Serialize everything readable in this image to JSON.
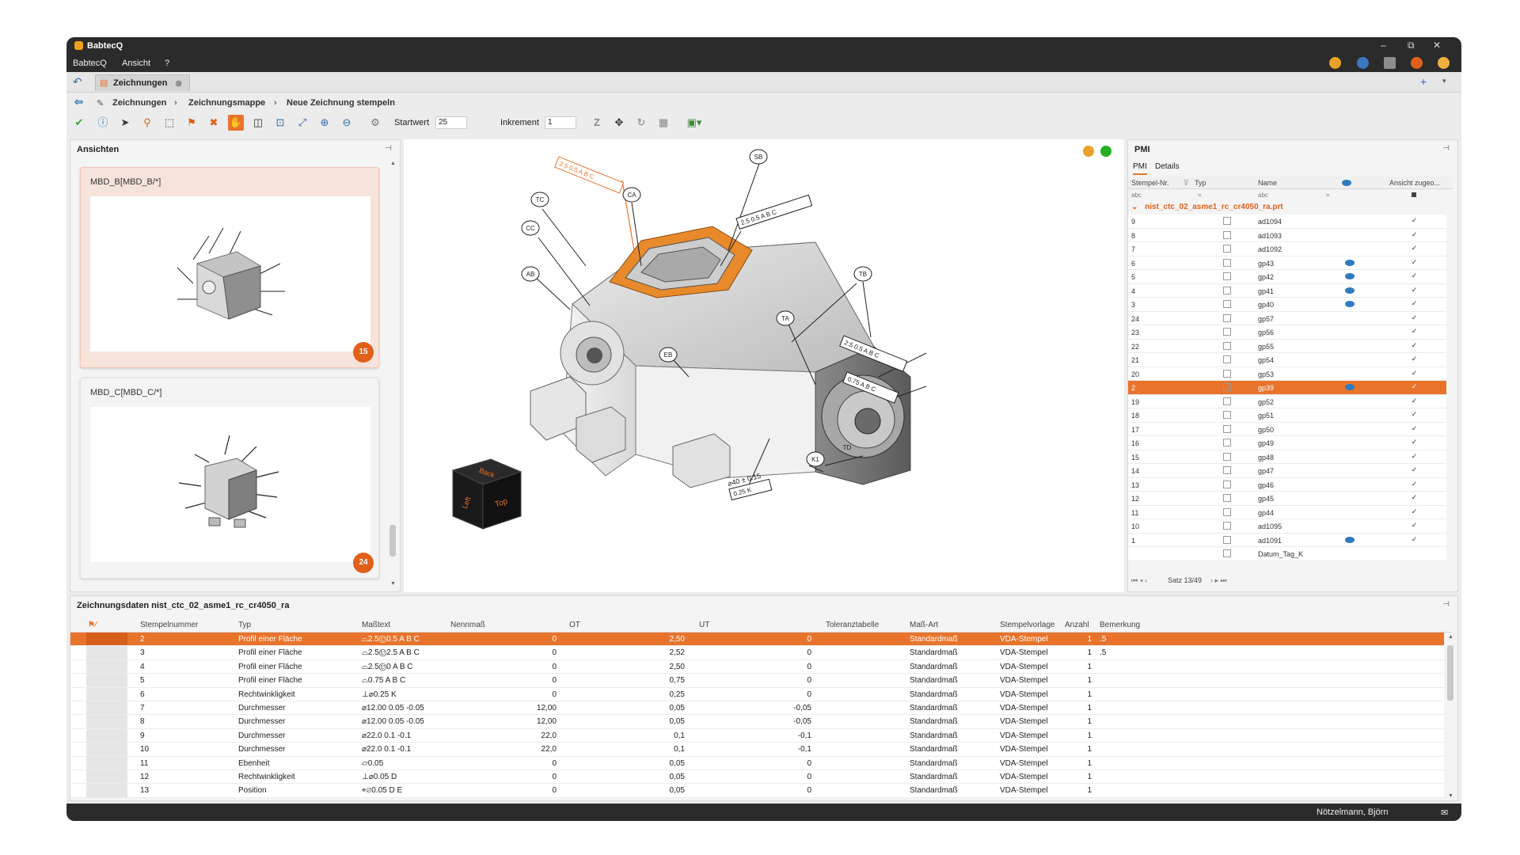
{
  "app": {
    "title": "BabtecQ",
    "window_controls": [
      "–",
      "⧉",
      "✕"
    ]
  },
  "menu": {
    "items": [
      "BabtecQ",
      "Ansicht",
      "?"
    ]
  },
  "tabs": [
    {
      "label": "Zeichnungen",
      "close": "⊗"
    }
  ],
  "breadcrumb": [
    "Zeichnungen",
    "Zeichnungsmappe",
    "Neue Zeichnung stempeln"
  ],
  "toolbar": {
    "startwert_label": "Startwert",
    "startwert_value": "25",
    "inkrement_label": "Inkrement",
    "inkrement_value": "1"
  },
  "ansichten": {
    "title": "Ansichten",
    "views": [
      {
        "label": "MBD_B[MBD_B/*]",
        "badge": "15"
      },
      {
        "label": "MBD_C[MBD_C/*]",
        "badge": "24"
      }
    ]
  },
  "viewer": {
    "cube_labels": [
      "Back",
      "Left",
      "Top"
    ],
    "annotations": [
      "2.5 0.5 A B C",
      "2.5 0.5 A B C",
      "2.5 0.5 A B C",
      "0.75 A B C",
      "⌀40 ± 0.15",
      "0.25 K",
      "SB",
      "CA",
      "TB",
      "TA",
      "AB",
      "EB",
      "CC",
      "TC",
      "TD",
      "K1"
    ]
  },
  "pmi": {
    "title": "PMI",
    "subtabs": [
      "PMI",
      "Details"
    ],
    "columns": [
      "Stempel-Nr.",
      "Typ",
      "Name",
      "Ansicht zugeo..."
    ],
    "filter": [
      "abc",
      "=",
      "abc",
      "="
    ],
    "group": "nist_ctc_02_asme1_rc_cr4050_ra.prt",
    "rows": [
      {
        "nr": "9",
        "name": "ad1094",
        "eye": false,
        "sel": false
      },
      {
        "nr": "8",
        "name": "ad1093",
        "eye": false,
        "sel": false
      },
      {
        "nr": "7",
        "name": "ad1092",
        "eye": false,
        "sel": false
      },
      {
        "nr": "6",
        "name": "gp43",
        "eye": true,
        "sel": false
      },
      {
        "nr": "5",
        "name": "gp42",
        "eye": true,
        "sel": false
      },
      {
        "nr": "4",
        "name": "gp41",
        "eye": true,
        "sel": false
      },
      {
        "nr": "3",
        "name": "gp40",
        "eye": true,
        "sel": false
      },
      {
        "nr": "24",
        "name": "gp57",
        "eye": false,
        "sel": false
      },
      {
        "nr": "23",
        "name": "gp56",
        "eye": false,
        "sel": false
      },
      {
        "nr": "22",
        "name": "gp55",
        "eye": false,
        "sel": false
      },
      {
        "nr": "21",
        "name": "gp54",
        "eye": false,
        "sel": false
      },
      {
        "nr": "20",
        "name": "gp53",
        "eye": false,
        "sel": false
      },
      {
        "nr": "2",
        "name": "gp39",
        "eye": true,
        "sel": true
      },
      {
        "nr": "19",
        "name": "gp52",
        "eye": false,
        "sel": false
      },
      {
        "nr": "18",
        "name": "gp51",
        "eye": false,
        "sel": false
      },
      {
        "nr": "17",
        "name": "gp50",
        "eye": false,
        "sel": false
      },
      {
        "nr": "16",
        "name": "gp49",
        "eye": false,
        "sel": false
      },
      {
        "nr": "15",
        "name": "gp48",
        "eye": false,
        "sel": false
      },
      {
        "nr": "14",
        "name": "gp47",
        "eye": false,
        "sel": false
      },
      {
        "nr": "13",
        "name": "gp46",
        "eye": false,
        "sel": false
      },
      {
        "nr": "12",
        "name": "gp45",
        "eye": false,
        "sel": false
      },
      {
        "nr": "11",
        "name": "gp44",
        "eye": false,
        "sel": false
      },
      {
        "nr": "10",
        "name": "ad1095",
        "eye": false,
        "sel": false
      },
      {
        "nr": "1",
        "name": "ad1091",
        "eye": true,
        "sel": false
      },
      {
        "nr": "",
        "name": "Datum_Tag_K",
        "eye": false,
        "sel": false
      }
    ],
    "pager": "Satz 13/49"
  },
  "data": {
    "title": "Zeichnungsdaten nist_ctc_02_asme1_rc_cr4050_ra",
    "columns": [
      "Stempelnummer",
      "Typ",
      "Maßtext",
      "Nennmaß",
      "OT",
      "UT",
      "Toleranztabelle",
      "Maß-Art",
      "Stempelvorlage",
      "Anzahl",
      "Bemerkung"
    ],
    "rows": [
      [
        "2",
        "Profil einer Fläche",
        "⌓2.5Ⓤ0.5 A B C",
        "0",
        "2,50",
        "0",
        "",
        "Standardmaß",
        "VDA-Stempel",
        "1",
        ".5"
      ],
      [
        "3",
        "Profil einer Fläche",
        "⌓2.5Ⓤ2.5 A B C",
        "0",
        "2,52",
        "0",
        "",
        "Standardmaß",
        "VDA-Stempel",
        "1",
        ".5"
      ],
      [
        "4",
        "Profil einer Fläche",
        "⌓2.5Ⓤ0 A B C",
        "0",
        "2,50",
        "0",
        "",
        "Standardmaß",
        "VDA-Stempel",
        "1",
        ""
      ],
      [
        "5",
        "Profil einer Fläche",
        "⌓0.75 A B C",
        "0",
        "0,75",
        "0",
        "",
        "Standardmaß",
        "VDA-Stempel",
        "1",
        ""
      ],
      [
        "6",
        "Rechtwinkligkeit",
        "⊥⌀0.25 K",
        "0",
        "0,25",
        "0",
        "",
        "Standardmaß",
        "VDA-Stempel",
        "1",
        ""
      ],
      [
        "7",
        "Durchmesser",
        "⌀12.00 0.05 -0.05",
        "12,00",
        "0,05",
        "-0,05",
        "",
        "Standardmaß",
        "VDA-Stempel",
        "1",
        ""
      ],
      [
        "8",
        "Durchmesser",
        "⌀12.00 0.05 -0.05",
        "12,00",
        "0,05",
        "-0,05",
        "",
        "Standardmaß",
        "VDA-Stempel",
        "1",
        ""
      ],
      [
        "9",
        "Durchmesser",
        "⌀22.0 0.1 -0.1",
        "22,0",
        "0,1",
        "-0,1",
        "",
        "Standardmaß",
        "VDA-Stempel",
        "1",
        ""
      ],
      [
        "10",
        "Durchmesser",
        "⌀22.0 0.1 -0.1",
        "22,0",
        "0,1",
        "-0,1",
        "",
        "Standardmaß",
        "VDA-Stempel",
        "1",
        ""
      ],
      [
        "11",
        "Ebenheit",
        "⏥0.05",
        "0",
        "0,05",
        "0",
        "",
        "Standardmaß",
        "VDA-Stempel",
        "1",
        ""
      ],
      [
        "12",
        "Rechtwinkligkeit",
        "⊥⌀0.05 D",
        "0",
        "0,05",
        "0",
        "",
        "Standardmaß",
        "VDA-Stempel",
        "1",
        ""
      ],
      [
        "13",
        "Position",
        "⌖⌀0.05 D E",
        "0",
        "0,05",
        "0",
        "",
        "Standardmaß",
        "VDA-Stempel",
        "1",
        ""
      ]
    ]
  },
  "status": {
    "user": "Nötzelmann, Björn"
  },
  "colors": {
    "accent": "#e8742b",
    "badge": "#e0601a",
    "dark": "#2b2b2b"
  }
}
